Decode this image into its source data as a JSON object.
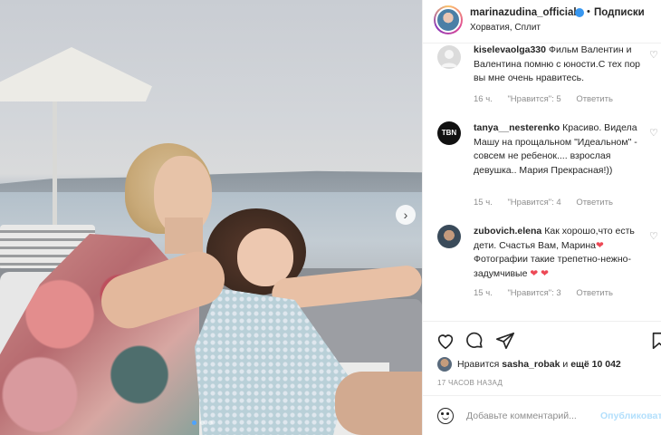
{
  "post": {
    "next_arrow": "›",
    "slides_count": 3,
    "active_slide": 1
  },
  "header": {
    "username": "marinazudina_official",
    "separator": "•",
    "follow_label": "Подписки",
    "location": "Хорватия, Сплит"
  },
  "comments": [
    {
      "username": "kiselevaolga330",
      "text": "Фильм Валентин и Валентина помню с юности.С тех пор вы мне очень нравитесь.",
      "time": "16 ч.",
      "likes": "\"Нравится\": 5",
      "reply": "Ответить",
      "avatar": "default-avatar"
    },
    {
      "username": "tanya__nesterenko",
      "text": "Красиво. Видела Машу на прощальном \"Идеальном\" - совсем не ребенок.... взрослая девушка.. Мария Прекрасная!))",
      "time": "15 ч.",
      "likes": "\"Нравится\": 4",
      "reply": "Ответить",
      "avatar": "tbn-logo-avatar",
      "avatar_text": "TBN"
    },
    {
      "username": "zubovich.elena",
      "text_parts": [
        "Как хорошо,что есть дети. Счастья Вам, Марина",
        "❤",
        " Фотографии такие трепетно-нежно-задумчивые ",
        "❤",
        " ",
        "❤"
      ],
      "time": "15 ч.",
      "likes": "\"Нравится\": 3",
      "reply": "Ответить",
      "avatar": "photo-avatar"
    }
  ],
  "actions": {
    "like_icon": "heart-icon",
    "comment_icon": "comment-icon",
    "share_icon": "share-icon",
    "save_icon": "bookmark-icon"
  },
  "likes": {
    "prefix": "Нравится",
    "user": "sasha_robak",
    "middle": "и",
    "others": "ещё 10 042"
  },
  "timeago": "17 ЧАСОВ НАЗАД",
  "add_comment": {
    "placeholder": "Добавьте комментарий...",
    "publish_label": "Опубликовать"
  },
  "colors": {
    "link_blue": "#b2dffc",
    "verified_blue": "#3897f0",
    "heart_red": "#ed4956",
    "muted_text": "#8e8e8e"
  }
}
